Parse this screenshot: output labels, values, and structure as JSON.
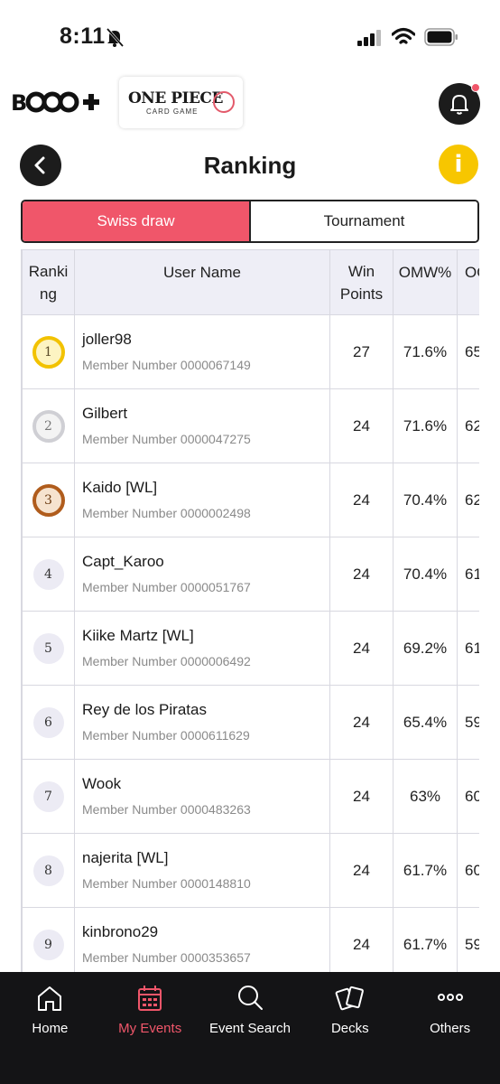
{
  "status_bar": {
    "time": "8:11"
  },
  "header": {
    "brand": "B",
    "game_logo_title": "ONE PIECE",
    "game_logo_sub": "CARD GAME"
  },
  "page": {
    "title": "Ranking",
    "info_label": "i"
  },
  "tabs": [
    {
      "label": "Swiss draw",
      "active": true
    },
    {
      "label": "Tournament",
      "active": false
    }
  ],
  "table": {
    "columns": [
      "Ranki ng",
      "User Name",
      "Win Points",
      "OMW%",
      "OO"
    ],
    "rows": [
      {
        "rank": "1",
        "name": "joller98",
        "member": "Member Number 0000067149",
        "points": "27",
        "omw": "71.6%",
        "oow": "65"
      },
      {
        "rank": "2",
        "name": "Gilbert",
        "member": "Member Number 0000047275",
        "points": "24",
        "omw": "71.6%",
        "oow": "62"
      },
      {
        "rank": "3",
        "name": "Kaido [WL]",
        "member": "Member Number 0000002498",
        "points": "24",
        "omw": "70.4%",
        "oow": "62"
      },
      {
        "rank": "4",
        "name": "Capt_Karoo",
        "member": "Member Number 0000051767",
        "points": "24",
        "omw": "70.4%",
        "oow": "61"
      },
      {
        "rank": "5",
        "name": "Kiike Martz [WL]",
        "member": "Member Number 0000006492",
        "points": "24",
        "omw": "69.2%",
        "oow": "61"
      },
      {
        "rank": "6",
        "name": "Rey de los Piratas",
        "member": "Member Number 0000611629",
        "points": "24",
        "omw": "65.4%",
        "oow": "59"
      },
      {
        "rank": "7",
        "name": "Wook",
        "member": "Member Number 0000483263",
        "points": "24",
        "omw": "63%",
        "oow": "60"
      },
      {
        "rank": "8",
        "name": "najerita [WL]",
        "member": "Member Number 0000148810",
        "points": "24",
        "omw": "61.7%",
        "oow": "60"
      },
      {
        "rank": "9",
        "name": "kinbrono29",
        "member": "Member Number 0000353657",
        "points": "24",
        "omw": "61.7%",
        "oow": "59"
      }
    ]
  },
  "nav": [
    {
      "label": "Home",
      "icon": "home-icon",
      "active": false
    },
    {
      "label": "My Events",
      "icon": "calendar-icon",
      "active": true
    },
    {
      "label": "Event Search",
      "icon": "search-icon",
      "active": false
    },
    {
      "label": "Decks",
      "icon": "cards-icon",
      "active": false
    },
    {
      "label": "Others",
      "icon": "more-icon",
      "active": false
    }
  ],
  "colors": {
    "accent": "#f0566a",
    "info": "#f7c600",
    "nav_bg": "#141416"
  }
}
